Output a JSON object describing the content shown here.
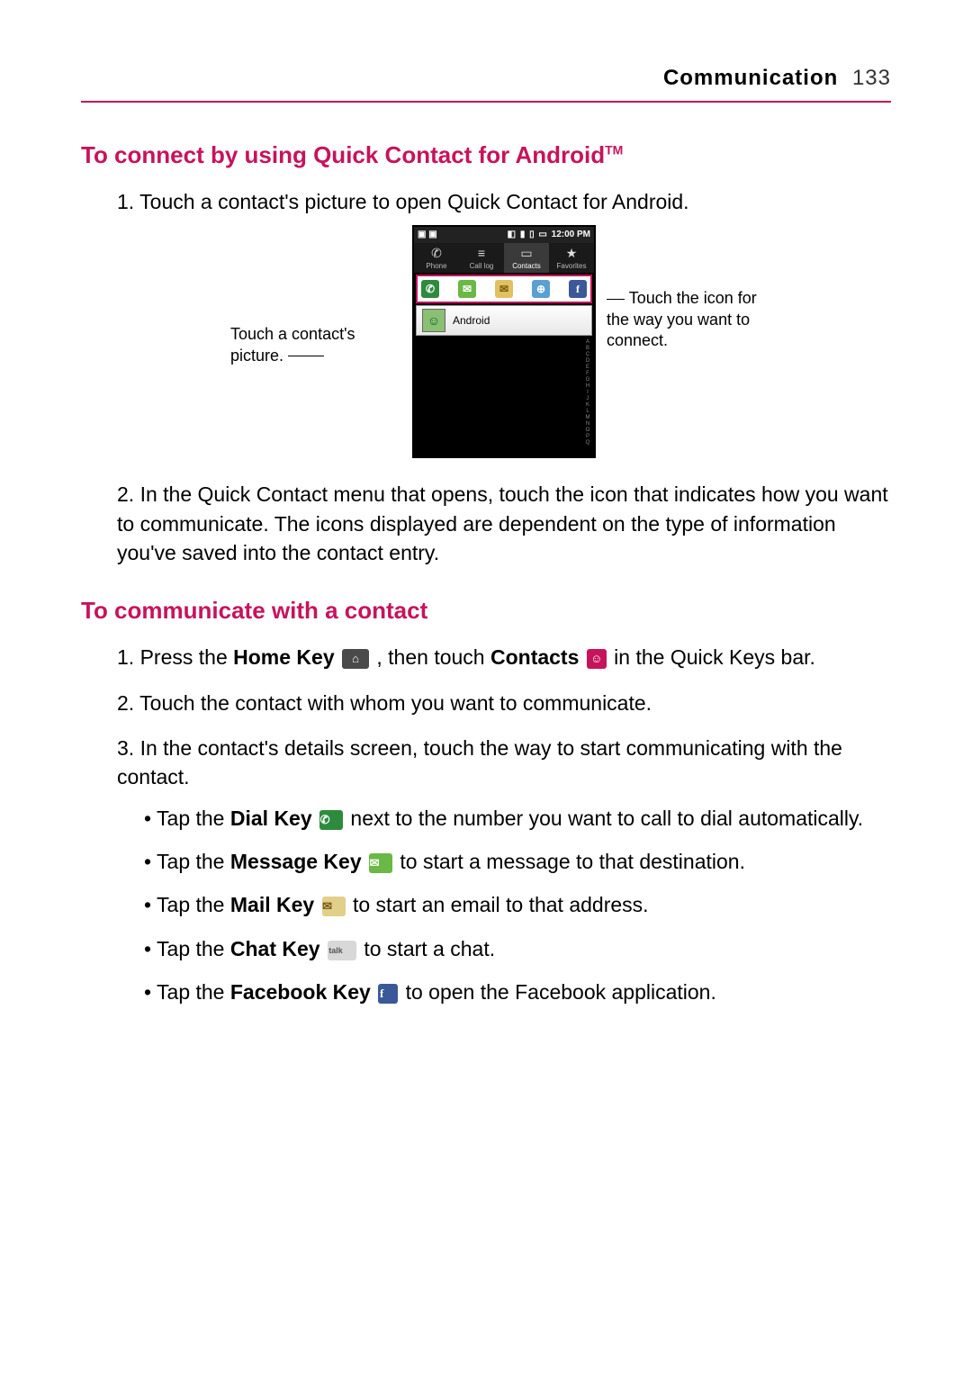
{
  "header": {
    "section": "Communication",
    "page_number": "133"
  },
  "s1": {
    "heading": "To connect by using Quick Contact for Android",
    "tm": "TM",
    "step1_num": "1. ",
    "step1_text": "Touch a contact's picture to open Quick Contact for Android.",
    "step2_num": "2. ",
    "step2_text": "In the Quick Contact menu that opens, touch the icon that indicates how you want to communicate. The icons displayed are dependent on the type of information you've saved into the contact entry.",
    "callout_left": "Touch a contact's picture.",
    "callout_right": "Touch the icon for the way you want to connect."
  },
  "phone": {
    "time": "12:00 PM",
    "tabs": {
      "phone": "Phone",
      "calllog": "Call log",
      "contacts": "Contacts",
      "favorites": "Favorites"
    },
    "contact_name": "Android",
    "alpha": "A B C D E F G H I J K L M N O P Q R S T U V W X Y Z"
  },
  "s2": {
    "heading": "To communicate with a contact",
    "step1_num": "1. ",
    "step1_a": "Press the ",
    "step1_home": "Home Key",
    "step1_b": " , then touch ",
    "step1_contacts": "Contacts",
    "step1_c": " in the Quick Keys bar.",
    "step2_num": "2. ",
    "step2_text": "Touch the contact with whom you want to communicate.",
    "step3_num": "3. ",
    "step3_text": "In the contact's details screen, touch the way to start communicating with the contact.",
    "b1_a": "Tap the ",
    "b1_key": "Dial Key",
    "b1_b": " next to the number you want to call to dial automatically.",
    "b2_a": "Tap the ",
    "b2_key": "Message Key",
    "b2_b": " to start a message to that destination.",
    "b3_a": "Tap the ",
    "b3_key": "Mail Key",
    "b3_b": " to start an email to that address.",
    "b4_a": "Tap the ",
    "b4_key": "Chat Key",
    "b4_b": " to start a chat.",
    "b5_a": "Tap the ",
    "b5_key": "Facebook Key",
    "b5_b": " to open the Facebook application."
  },
  "glyphs": {
    "home": "⌂",
    "contacts": "☺",
    "dial": "✆",
    "msg": "✉",
    "mail": "✉",
    "chat": "talk",
    "fb": "f",
    "avatar": "☺",
    "web": "⊕",
    "t_phone": "✆",
    "t_log": "≡",
    "t_contacts": "▭",
    "t_fav": "★",
    "sb_left": "▣ ▣",
    "sb_r1": "◧",
    "sb_r2": "▮",
    "sb_r3": "▯",
    "sb_bat": "▭"
  }
}
